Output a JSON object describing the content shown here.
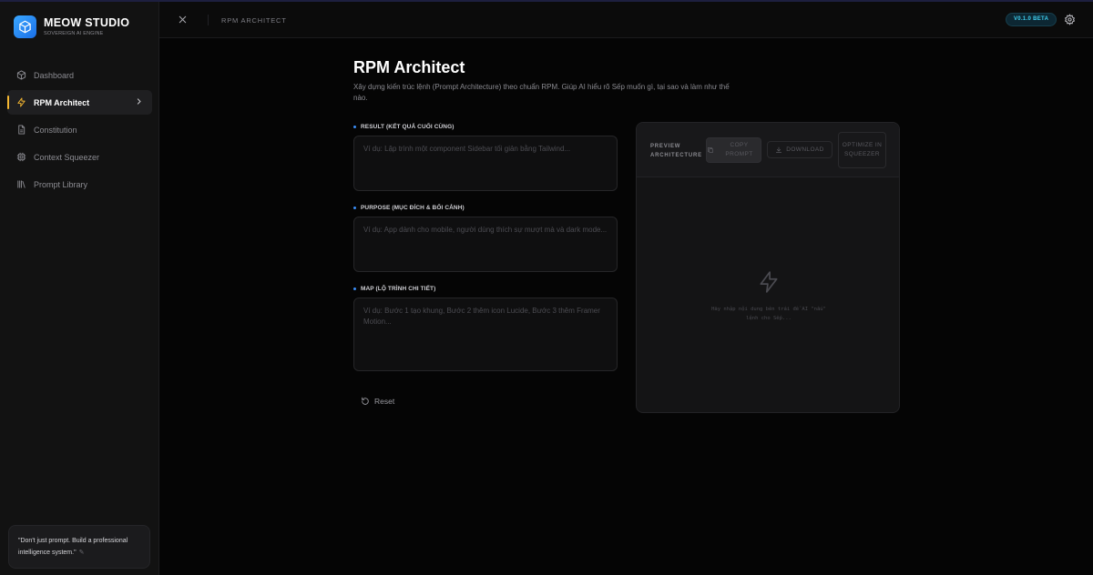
{
  "brand": {
    "title": "MEOW STUDIO",
    "subtitle": "SOVEREIGN AI ENGINE",
    "accent": "#2f8cf5"
  },
  "sidebar": {
    "items": [
      {
        "label": "Dashboard",
        "icon": "cube-icon",
        "active": false
      },
      {
        "label": "RPM Architect",
        "icon": "zap-icon",
        "active": true
      },
      {
        "label": "Constitution",
        "icon": "document-icon",
        "active": false
      },
      {
        "label": "Context Squeezer",
        "icon": "chip-icon",
        "active": false
      },
      {
        "label": "Prompt Library",
        "icon": "library-icon",
        "active": false
      }
    ],
    "active_color": "#f5b731",
    "quote": "\"Don't just prompt. Build a professional intelligence system.\""
  },
  "topbar": {
    "breadcrumb": "RPM ARCHITECT",
    "version": "V0.1.0 BETA",
    "version_color": "#3fd0f0"
  },
  "main": {
    "title": "RPM Architect",
    "description": "Xây dựng kiến trúc lệnh (Prompt Architecture) theo chuẩn RPM. Giúp AI hiểu rõ Sếp muốn gì, tại sao và làm như thế nào.",
    "fields": {
      "result": {
        "label": "RESULT (KẾT QUẢ CUỐI CÙNG)",
        "value": "",
        "placeholder": "Ví dụ: Lập trình một component Sidebar tối giản bằng Tailwind..."
      },
      "purpose": {
        "label": "PURPOSE (MỤC ĐÍCH & BỐI CẢNH)",
        "value": "",
        "placeholder": "Ví dụ: App dành cho mobile, người dùng thích sự mượt mà và dark mode..."
      },
      "map": {
        "label": "MAP (LỘ TRÌNH CHI TIẾT)",
        "value": "",
        "placeholder": "Ví dụ: Bước 1 tạo khung, Bước 2 thêm icon Lucide, Bước 3 thêm Framer Motion..."
      }
    },
    "reset_label": "Reset"
  },
  "preview": {
    "title": "PREVIEW ARCHITECTURE",
    "copy_label": "COPY PROMPT",
    "download_label": "DOWNLOAD",
    "optimize_label": "OPTIMIZE IN SQUEEZER",
    "empty_text": "Hãy nhập nội dung bên trái để AI \"nấu\" lệnh cho Sếp..."
  }
}
